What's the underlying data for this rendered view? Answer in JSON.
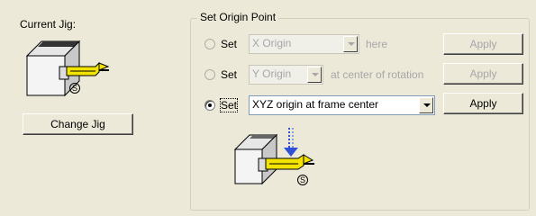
{
  "current_jig": {
    "label": "Current Jig:",
    "s_marker": "S",
    "change_button": "Change Jig"
  },
  "origin_group": {
    "title": "Set Origin Point",
    "rows": [
      {
        "radio_label": "Set",
        "combo_value": "X Origin",
        "suffix": "here",
        "apply": "Apply",
        "selected": false,
        "enabled": false
      },
      {
        "radio_label": "Set",
        "combo_value": "Y Origin",
        "suffix": "at center of rotation",
        "apply": "Apply",
        "selected": false,
        "enabled": false
      },
      {
        "radio_label": "Set",
        "combo_value": "XYZ origin at frame center",
        "suffix": "",
        "apply": "Apply",
        "selected": true,
        "enabled": true
      }
    ],
    "s_marker": "S"
  },
  "colors": {
    "jig_body": "#f4f4f4",
    "spindle": "#f2e400",
    "target_arrow": "#3050d8"
  }
}
